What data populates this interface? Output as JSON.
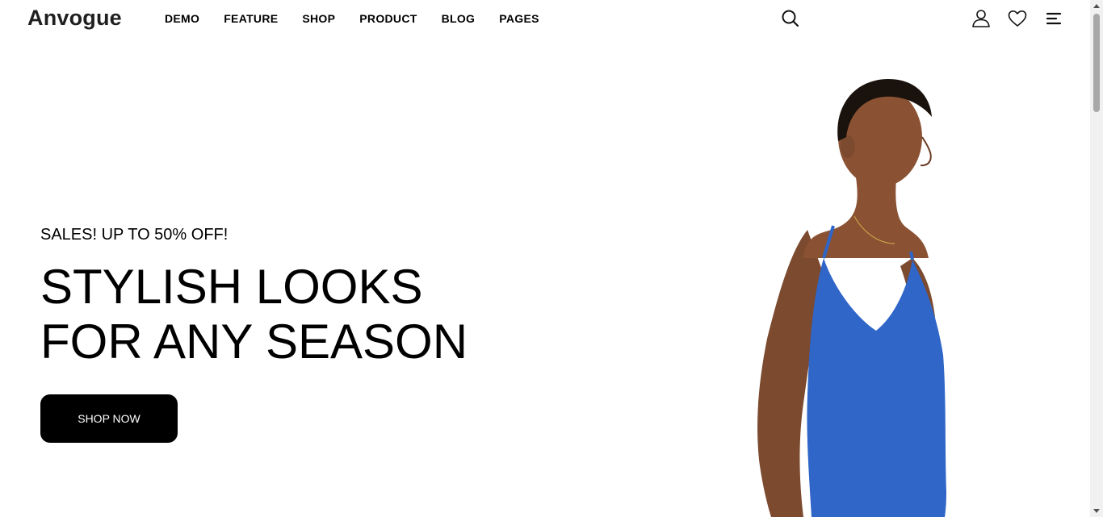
{
  "header": {
    "logo": "Anvogue",
    "nav": [
      {
        "label": "DEMO"
      },
      {
        "label": "FEATURE"
      },
      {
        "label": "SHOP"
      },
      {
        "label": "PRODUCT"
      },
      {
        "label": "BLOG"
      },
      {
        "label": "PAGES"
      }
    ],
    "icons": [
      "search-icon",
      "user-icon",
      "heart-icon",
      "menu-icon"
    ]
  },
  "hero": {
    "subtitle": "SALES! UP TO 50% OFF!",
    "headline_line1": "STYLISH LOOKS",
    "headline_line2": "FOR ANY SEASON",
    "cta_label": "SHOP NOW"
  },
  "colors": {
    "background": "#ffffff",
    "text": "#000000",
    "button_bg": "#000000",
    "button_text": "#ffffff",
    "swimsuit": "#2f66c8",
    "skin": "#8a5233"
  }
}
